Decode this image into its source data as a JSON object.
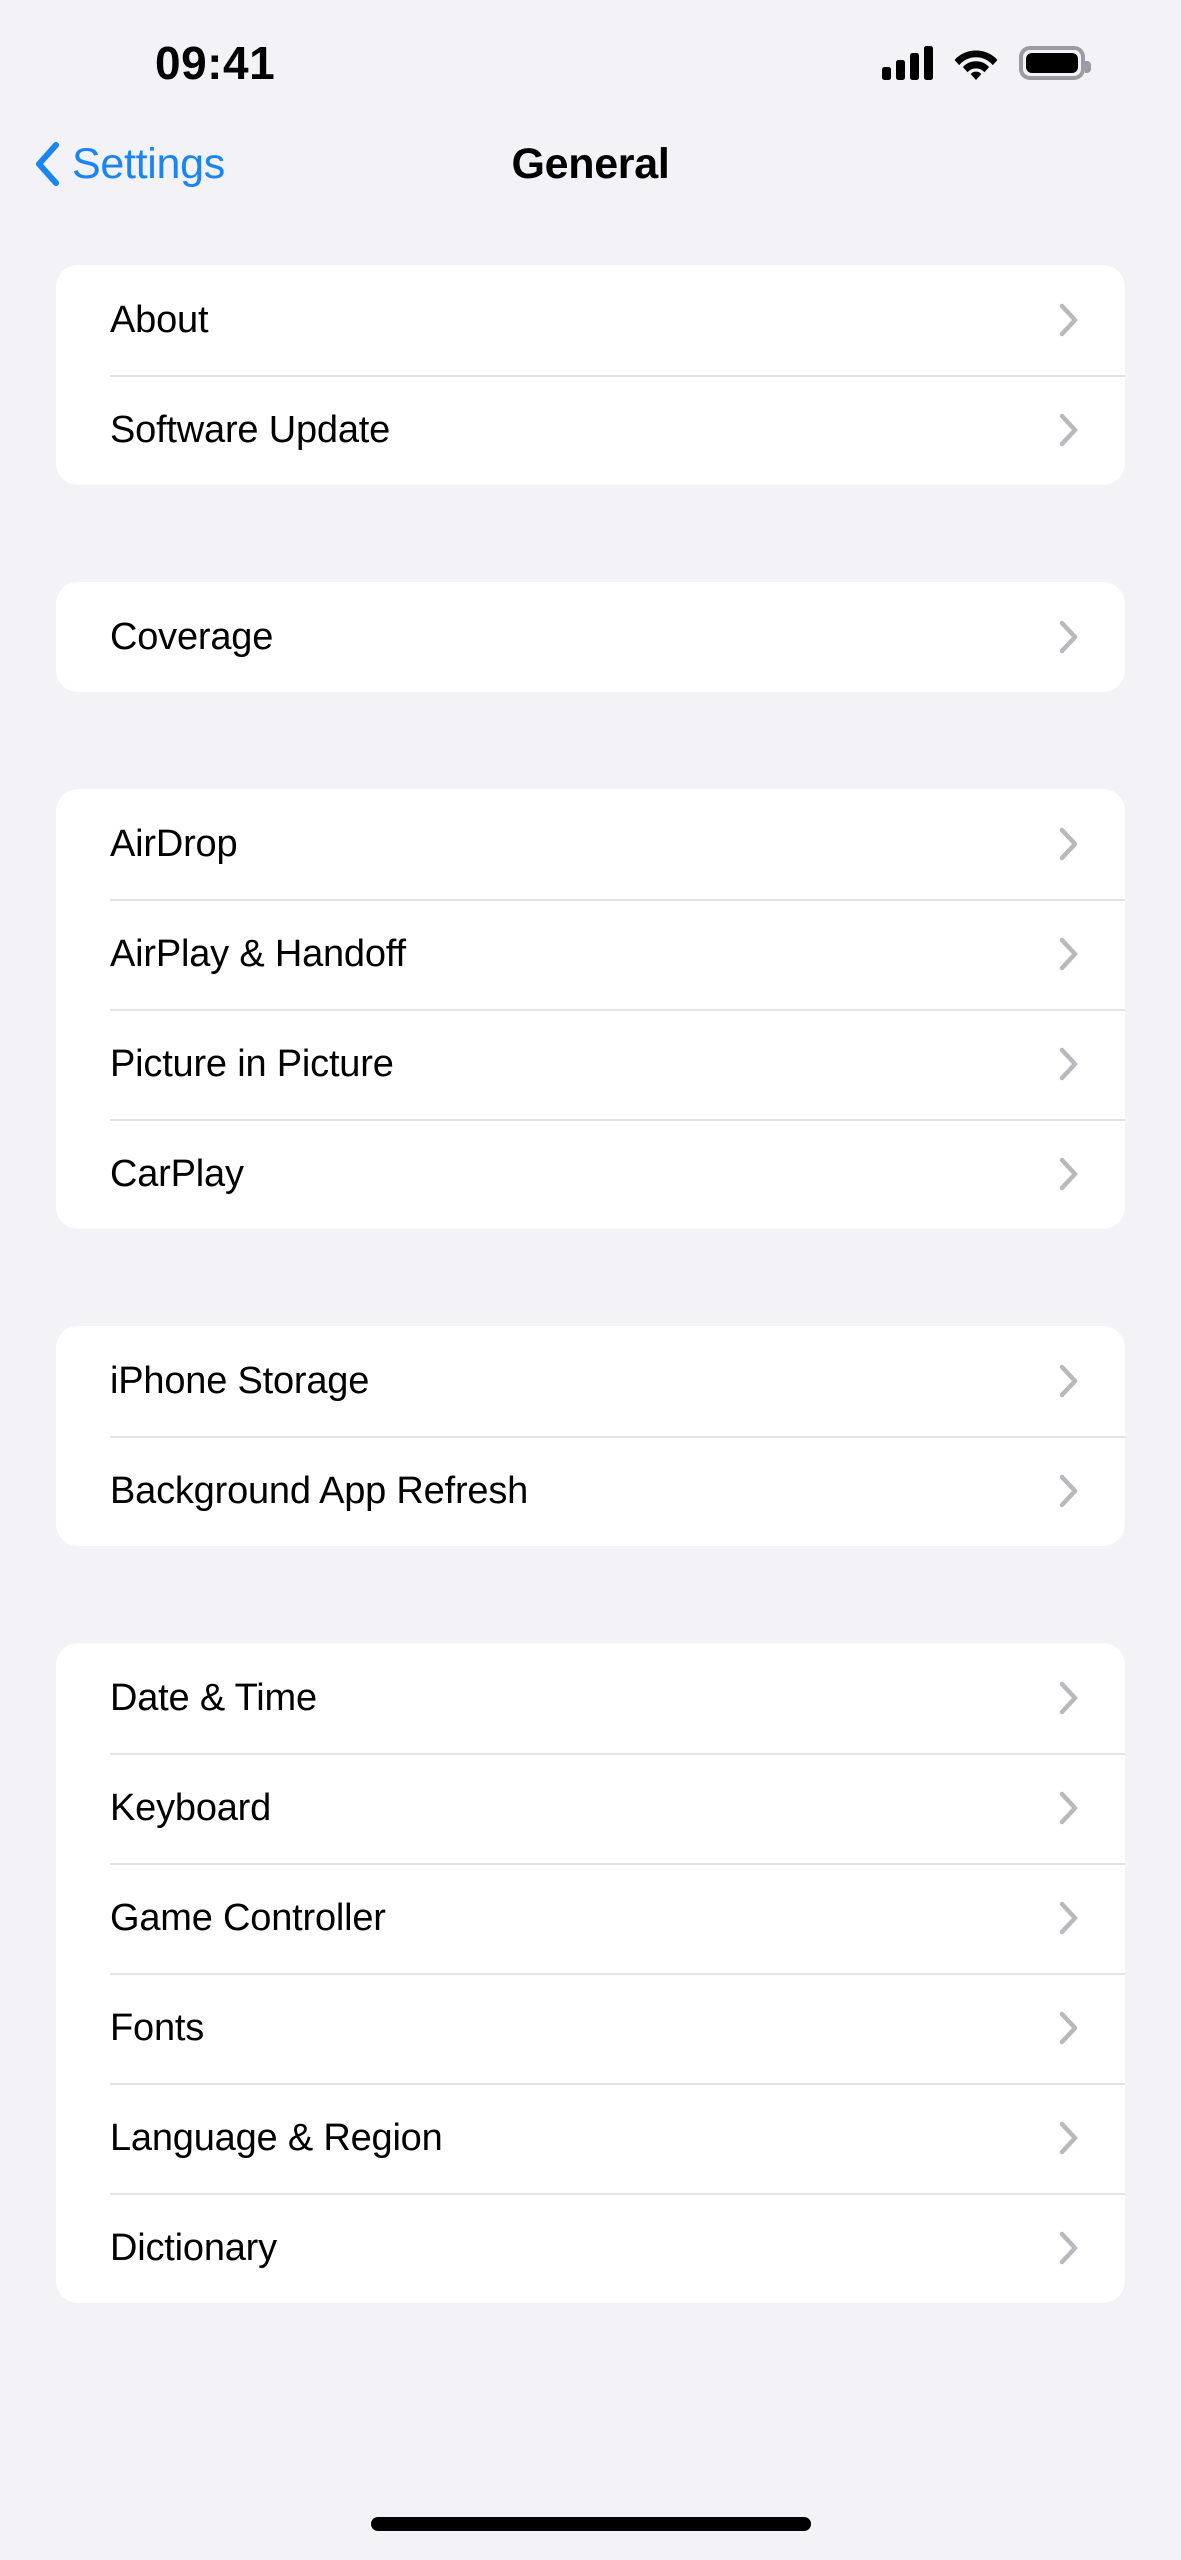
{
  "status_bar": {
    "time": "09:41",
    "icons": {
      "cellular": "cellular-signal-icon",
      "wifi": "wifi-icon",
      "battery": "battery-full-icon"
    }
  },
  "nav": {
    "back_label": "Settings",
    "back_icon": "chevron-left-icon",
    "title": "General"
  },
  "groups": [
    {
      "id": "group-device-info",
      "rows": [
        {
          "label": "About",
          "accessory": "chevron-right-icon"
        },
        {
          "label": "Software Update",
          "accessory": "chevron-right-icon"
        }
      ]
    },
    {
      "id": "group-coverage",
      "rows": [
        {
          "label": "Coverage",
          "accessory": "chevron-right-icon"
        }
      ]
    },
    {
      "id": "group-connectivity",
      "rows": [
        {
          "label": "AirDrop",
          "accessory": "chevron-right-icon"
        },
        {
          "label": "AirPlay & Handoff",
          "accessory": "chevron-right-icon"
        },
        {
          "label": "Picture in Picture",
          "accessory": "chevron-right-icon"
        },
        {
          "label": "CarPlay",
          "accessory": "chevron-right-icon"
        }
      ]
    },
    {
      "id": "group-storage",
      "rows": [
        {
          "label": "iPhone Storage",
          "accessory": "chevron-right-icon"
        },
        {
          "label": "Background App Refresh",
          "accessory": "chevron-right-icon"
        }
      ]
    },
    {
      "id": "group-localization",
      "rows": [
        {
          "label": "Date & Time",
          "accessory": "chevron-right-icon"
        },
        {
          "label": "Keyboard",
          "accessory": "chevron-right-icon"
        },
        {
          "label": "Game Controller",
          "accessory": "chevron-right-icon"
        },
        {
          "label": "Fonts",
          "accessory": "chevron-right-icon"
        },
        {
          "label": "Language & Region",
          "accessory": "chevron-right-icon"
        },
        {
          "label": "Dictionary",
          "accessory": "chevron-right-icon"
        }
      ]
    }
  ],
  "home_indicator": "home-indicator-bar",
  "colors": {
    "background": "#F2F2F7",
    "card": "#FFFFFF",
    "accent_blue": "#1A84F0",
    "label": "#000000",
    "separator": "#E3E3E6",
    "chevron": "#B8B8BD",
    "battery_outline": "#9B9BA1"
  }
}
